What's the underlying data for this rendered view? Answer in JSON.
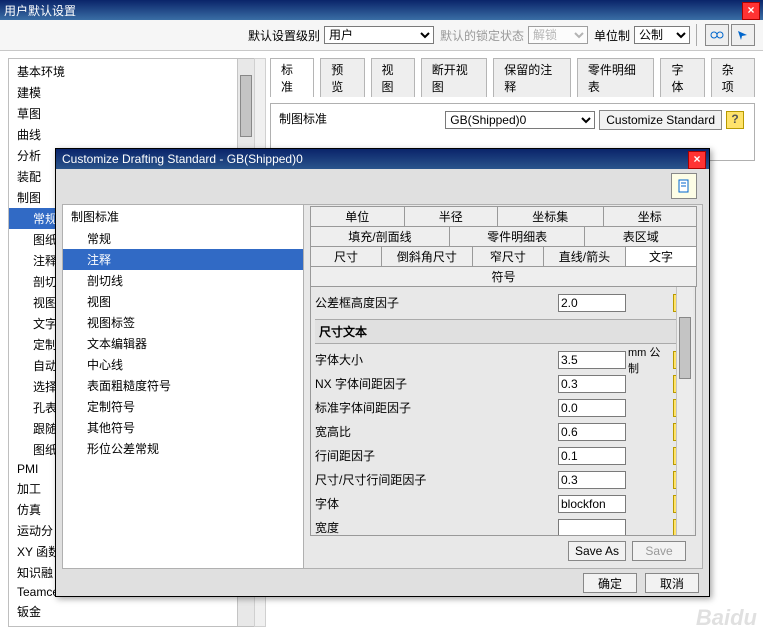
{
  "main": {
    "title": "用户默认设置",
    "top": {
      "level_label": "默认设置级别",
      "level_value": "用户",
      "lock_label": "默认的锁定状态",
      "lock_value": "解锁",
      "unit_label": "单位制",
      "unit_value": "公制"
    },
    "tabs": [
      "标准",
      "预览",
      "视图",
      "断开视图",
      "保留的注释",
      "零件明细表",
      "字体",
      "杂项"
    ],
    "group": {
      "label": "制图标准",
      "dropdown": "GB(Shipped)0",
      "customize": "Customize Standard"
    },
    "tree": [
      "基本环境",
      "建模",
      "草图",
      "曲线",
      "分析",
      "装配",
      "制图"
    ],
    "tree_sub": [
      "常规",
      "图纸",
      "注释",
      "剖切线",
      "视图",
      "文字",
      "定制",
      "自动",
      "选择",
      "孔表",
      "跟随",
      "图纸"
    ],
    "tree_after": [
      "PMI",
      "加工",
      "仿真",
      "运动分",
      "XY 函数",
      "知识融",
      "Teamce",
      "钣金"
    ]
  },
  "modal": {
    "title": "Customize Drafting Standard - GB(Shipped)0",
    "left_header": "制图标准",
    "tree": [
      "常规",
      "注释",
      "剖切线",
      "视图",
      "视图标签",
      "文本编辑器",
      "中心线",
      "表面粗糙度符号",
      "定制符号",
      "其他符号",
      "形位公差常规"
    ],
    "tree_sel": 1,
    "tabs1": [
      "单位",
      "半径",
      "坐标集",
      "坐标"
    ],
    "tabs2": [
      "填充/剖面线",
      "零件明细表",
      "表区域"
    ],
    "tabs3": [
      "尺寸",
      "倒斜角尺寸",
      "窄尺寸",
      "直线/箭头",
      "文字",
      "符号"
    ],
    "tabs3_sel": 4,
    "row_top_label": "公差框高度因子",
    "row_top_value": "2.0",
    "section_title": "尺寸文本",
    "rows": [
      {
        "label": "字体大小",
        "value": "3.5",
        "unit": "mm 公制"
      },
      {
        "label": "NX 字体间距因子",
        "value": "0.3",
        "unit": ""
      },
      {
        "label": "标准字体间距因子",
        "value": "0.0",
        "unit": ""
      },
      {
        "label": "宽高比",
        "value": "0.6",
        "unit": ""
      },
      {
        "label": "行间距因子",
        "value": "0.1",
        "unit": ""
      },
      {
        "label": "尺寸/尺寸行间距因子",
        "value": "0.3",
        "unit": ""
      },
      {
        "label": "字体",
        "value": "blockfon",
        "unit": ""
      },
      {
        "label": "宽度",
        "value": "",
        "unit": ""
      }
    ],
    "save_as": "Save As",
    "save": "Save",
    "ok": "确定",
    "cancel": "取消"
  },
  "watermark": "Baidu"
}
